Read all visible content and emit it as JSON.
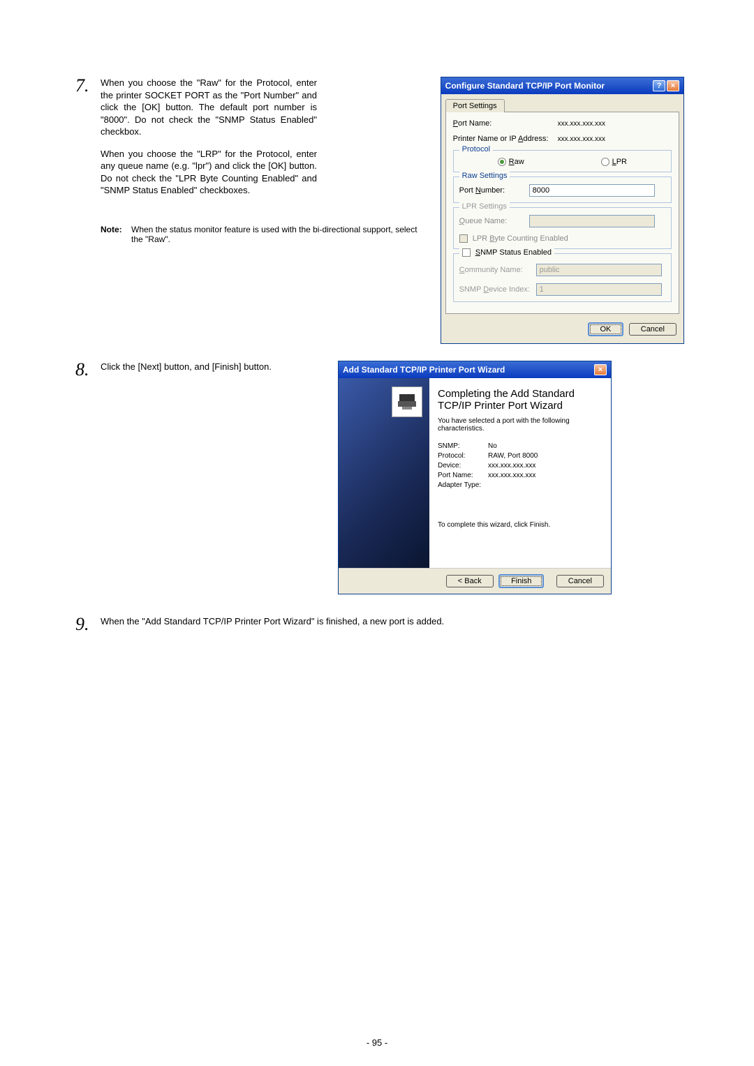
{
  "steps": {
    "s7": {
      "num": "7.",
      "p1": "When you choose the \"Raw\" for the Protocol, enter the printer SOCKET PORT as the \"Port Number\" and click the [OK] button.  The default port number is \"8000\".  Do not check the \"SNMP Status Enabled\" checkbox.",
      "p2": "When you choose the \"LRP\" for the Protocol, enter any queue name (e.g. \"lpr\") and click the [OK] button.  Do not check the \"LPR Byte Counting Enabled\" and \"SNMP Status Enabled\" checkboxes.",
      "note_label": "Note:",
      "note_body": "When the status monitor feature is used with the bi-directional support, select the \"Raw\"."
    },
    "s8": {
      "num": "8.",
      "text": "Click the [Next] button, and [Finish] button."
    },
    "s9": {
      "num": "9.",
      "text": "When the \"Add Standard TCP/IP Printer Port Wizard\" is finished, a new port is added."
    }
  },
  "dialog1": {
    "title": "Configure Standard TCP/IP Port Monitor",
    "tab": "Port Settings",
    "port_name_lbl": "Port Name:",
    "port_name_val": "xxx.xxx.xxx.xxx",
    "printer_ip_lbl": "Printer Name or IP Address:",
    "printer_ip_val": "xxx.xxx.xxx.xxx",
    "protocol_group": "Protocol",
    "raw_label": "Raw",
    "lpr_label": "LPR",
    "raw_group": "Raw Settings",
    "port_number_lbl": "Port Number:",
    "port_number_val": "8000",
    "lpr_group": "LPR Settings",
    "queue_name_lbl": "Queue Name:",
    "lpr_byte_lbl": "LPR Byte Counting Enabled",
    "snmp_lbl": "SNMP Status Enabled",
    "community_lbl": "Community Name:",
    "community_val": "public",
    "device_idx_lbl": "SNMP Device Index:",
    "device_idx_val": "1",
    "ok": "OK",
    "cancel": "Cancel"
  },
  "dialog2": {
    "title": "Add Standard TCP/IP Printer Port Wizard",
    "heading": "Completing the Add Standard TCP/IP Printer Port Wizard",
    "sub": "You have selected a port with the following characteristics.",
    "snmp_k": "SNMP:",
    "snmp_v": "No",
    "proto_k": "Protocol:",
    "proto_v": "RAW, Port 8000",
    "device_k": "Device:",
    "device_v": "xxx.xxx.xxx.xxx",
    "portname_k": "Port Name:",
    "portname_v": "xxx.xxx.xxx.xxx",
    "adapter_k": "Adapter Type:",
    "adapter_v": "",
    "complete": "To complete this wizard, click Finish.",
    "back": "< Back",
    "finish": "Finish",
    "cancel": "Cancel"
  },
  "page_number": "- 95 -"
}
